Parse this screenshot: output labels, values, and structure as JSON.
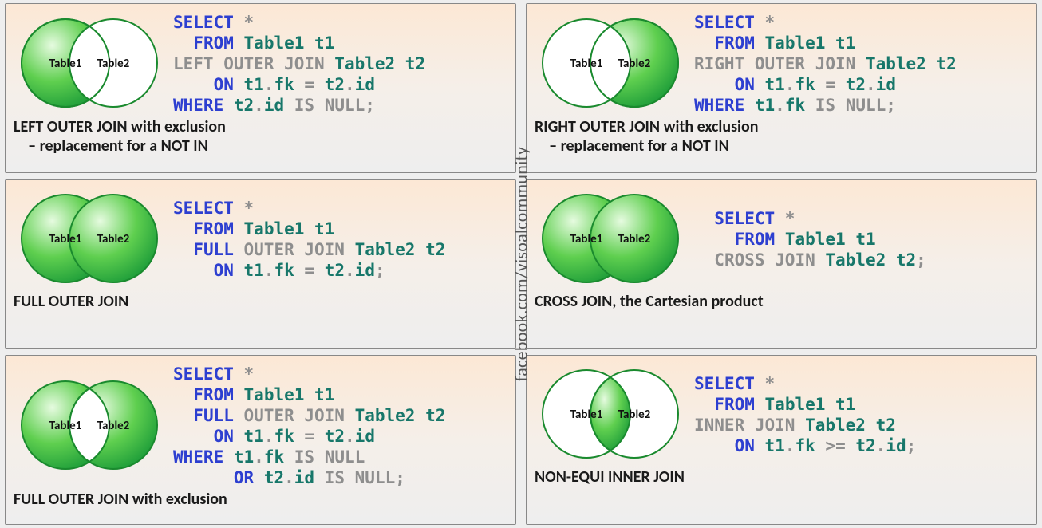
{
  "watermark": "facebook.com/visoalcommunity",
  "venn_labels": {
    "left": "Table1",
    "right": "Table2"
  },
  "cards": [
    {
      "id": "left-excl",
      "venn": "left-only",
      "title": "LEFT OUTER JOIN with exclusion\n    – replacement for a NOT IN",
      "code": [
        {
          "indent": 0,
          "t": [
            [
              "kw",
              "SELECT"
            ],
            [
              "gr",
              " *"
            ]
          ]
        },
        {
          "indent": 1,
          "t": [
            [
              "kw",
              "FROM"
            ],
            [
              "gr",
              " "
            ],
            [
              "gn",
              "Table1 t1"
            ]
          ]
        },
        {
          "indent": 0,
          "t": [
            [
              "gr",
              "LEFT OUTER JOIN "
            ],
            [
              "gn",
              "Table2 t2"
            ]
          ]
        },
        {
          "indent": 2,
          "t": [
            [
              "kw",
              "ON"
            ],
            [
              "gr",
              " "
            ],
            [
              "gn",
              "t1"
            ],
            [
              "gr",
              "."
            ],
            [
              "gn",
              "fk"
            ],
            [
              "gr",
              " = "
            ],
            [
              "gn",
              "t2"
            ],
            [
              "gr",
              "."
            ],
            [
              "gn",
              "id"
            ]
          ]
        },
        {
          "indent": 0,
          "t": [
            [
              "kw",
              "WHERE"
            ],
            [
              "gr",
              " "
            ],
            [
              "gn",
              "t2"
            ],
            [
              "gr",
              "."
            ],
            [
              "gn",
              "id"
            ],
            [
              "gr",
              " IS NULL;"
            ]
          ]
        }
      ]
    },
    {
      "id": "full",
      "venn": "full",
      "title": "FULL OUTER JOIN",
      "code": [
        {
          "indent": 0,
          "t": [
            [
              "kw",
              "SELECT"
            ],
            [
              "gr",
              " *"
            ]
          ]
        },
        {
          "indent": 1,
          "t": [
            [
              "kw",
              "FROM"
            ],
            [
              "gr",
              " "
            ],
            [
              "gn",
              "Table1 t1"
            ]
          ]
        },
        {
          "indent": 1,
          "t": [
            [
              "kw",
              "FULL"
            ],
            [
              "gr",
              " OUTER JOIN "
            ],
            [
              "gn",
              "Table2 t2"
            ]
          ]
        },
        {
          "indent": 2,
          "t": [
            [
              "kw",
              "ON"
            ],
            [
              "gr",
              " "
            ],
            [
              "gn",
              "t1"
            ],
            [
              "gr",
              "."
            ],
            [
              "gn",
              "fk"
            ],
            [
              "gr",
              " = "
            ],
            [
              "gn",
              "t2"
            ],
            [
              "gr",
              "."
            ],
            [
              "gn",
              "id"
            ],
            [
              "gr",
              ";"
            ]
          ]
        }
      ]
    },
    {
      "id": "full-excl",
      "venn": "symmetric-diff",
      "title": "FULL OUTER JOIN with exclusion",
      "code": [
        {
          "indent": 0,
          "t": [
            [
              "kw",
              "SELECT"
            ],
            [
              "gr",
              " *"
            ]
          ]
        },
        {
          "indent": 1,
          "t": [
            [
              "kw",
              "FROM"
            ],
            [
              "gr",
              " "
            ],
            [
              "gn",
              "Table1 t1"
            ]
          ]
        },
        {
          "indent": 1,
          "t": [
            [
              "kw",
              "FULL"
            ],
            [
              "gr",
              " OUTER JOIN "
            ],
            [
              "gn",
              "Table2 t2"
            ]
          ]
        },
        {
          "indent": 2,
          "t": [
            [
              "kw",
              "ON"
            ],
            [
              "gr",
              " "
            ],
            [
              "gn",
              "t1"
            ],
            [
              "gr",
              "."
            ],
            [
              "gn",
              "fk"
            ],
            [
              "gr",
              " = "
            ],
            [
              "gn",
              "t2"
            ],
            [
              "gr",
              "."
            ],
            [
              "gn",
              "id"
            ]
          ]
        },
        {
          "indent": 0,
          "t": [
            [
              "kw",
              "WHERE"
            ],
            [
              "gr",
              " "
            ],
            [
              "gn",
              "t1"
            ],
            [
              "gr",
              "."
            ],
            [
              "gn",
              "fk"
            ],
            [
              "gr",
              " IS NULL"
            ]
          ]
        },
        {
          "indent": 3,
          "t": [
            [
              "kw",
              "OR"
            ],
            [
              "gr",
              " "
            ],
            [
              "gn",
              "t2"
            ],
            [
              "gr",
              "."
            ],
            [
              "gn",
              "id"
            ],
            [
              "gr",
              " IS NULL;"
            ]
          ]
        }
      ]
    },
    {
      "id": "right-excl",
      "venn": "right-only",
      "title": "RIGHT OUTER JOIN with exclusion\n    – replacement for a NOT IN",
      "code": [
        {
          "indent": 0,
          "t": [
            [
              "kw",
              "SELECT"
            ],
            [
              "gr",
              " *"
            ]
          ]
        },
        {
          "indent": 1,
          "t": [
            [
              "kw",
              "FROM"
            ],
            [
              "gr",
              " "
            ],
            [
              "gn",
              "Table1 t1"
            ]
          ]
        },
        {
          "indent": 0,
          "t": [
            [
              "gr",
              "RIGHT OUTER JOIN "
            ],
            [
              "gn",
              "Table2 t2"
            ]
          ]
        },
        {
          "indent": 2,
          "t": [
            [
              "kw",
              "ON"
            ],
            [
              "gr",
              " "
            ],
            [
              "gn",
              "t1"
            ],
            [
              "gr",
              "."
            ],
            [
              "gn",
              "fk"
            ],
            [
              "gr",
              " = "
            ],
            [
              "gn",
              "t2"
            ],
            [
              "gr",
              "."
            ],
            [
              "gn",
              "id"
            ]
          ]
        },
        {
          "indent": 0,
          "t": [
            [
              "kw",
              "WHERE"
            ],
            [
              "gr",
              " "
            ],
            [
              "gn",
              "t1"
            ],
            [
              "gr",
              "."
            ],
            [
              "gn",
              "fk"
            ],
            [
              "gr",
              " IS NULL;"
            ]
          ]
        }
      ]
    },
    {
      "id": "cross",
      "venn": "full",
      "title": "CROSS JOIN, the Cartesian product",
      "code": [
        {
          "indent": 1,
          "t": [
            [
              "kw",
              "SELECT"
            ],
            [
              "gr",
              " *"
            ]
          ]
        },
        {
          "indent": 2,
          "t": [
            [
              "kw",
              "FROM"
            ],
            [
              "gr",
              " "
            ],
            [
              "gn",
              "Table1 t1"
            ]
          ]
        },
        {
          "indent": 1,
          "t": [
            [
              "gr",
              "CROSS JOIN "
            ],
            [
              "gn",
              "Table2 t2"
            ],
            [
              "gr",
              ";"
            ]
          ]
        }
      ]
    },
    {
      "id": "non-equi",
      "venn": "inner",
      "title": "NON-EQUI INNER JOIN",
      "code": [
        {
          "indent": 0,
          "t": [
            [
              "kw",
              "SELECT"
            ],
            [
              "gr",
              " *"
            ]
          ]
        },
        {
          "indent": 1,
          "t": [
            [
              "kw",
              "FROM"
            ],
            [
              "gr",
              " "
            ],
            [
              "gn",
              "Table1 t1"
            ]
          ]
        },
        {
          "indent": 0,
          "t": [
            [
              "gr",
              "INNER JOIN "
            ],
            [
              "gn",
              "Table2 t2"
            ]
          ]
        },
        {
          "indent": 2,
          "t": [
            [
              "kw",
              "ON"
            ],
            [
              "gr",
              " "
            ],
            [
              "gn",
              "t1"
            ],
            [
              "gr",
              "."
            ],
            [
              "gn",
              "fk"
            ],
            [
              "gr",
              " >= "
            ],
            [
              "gn",
              "t2"
            ],
            [
              "gr",
              "."
            ],
            [
              "gn",
              "id"
            ],
            [
              "gr",
              ";"
            ]
          ]
        }
      ]
    }
  ]
}
